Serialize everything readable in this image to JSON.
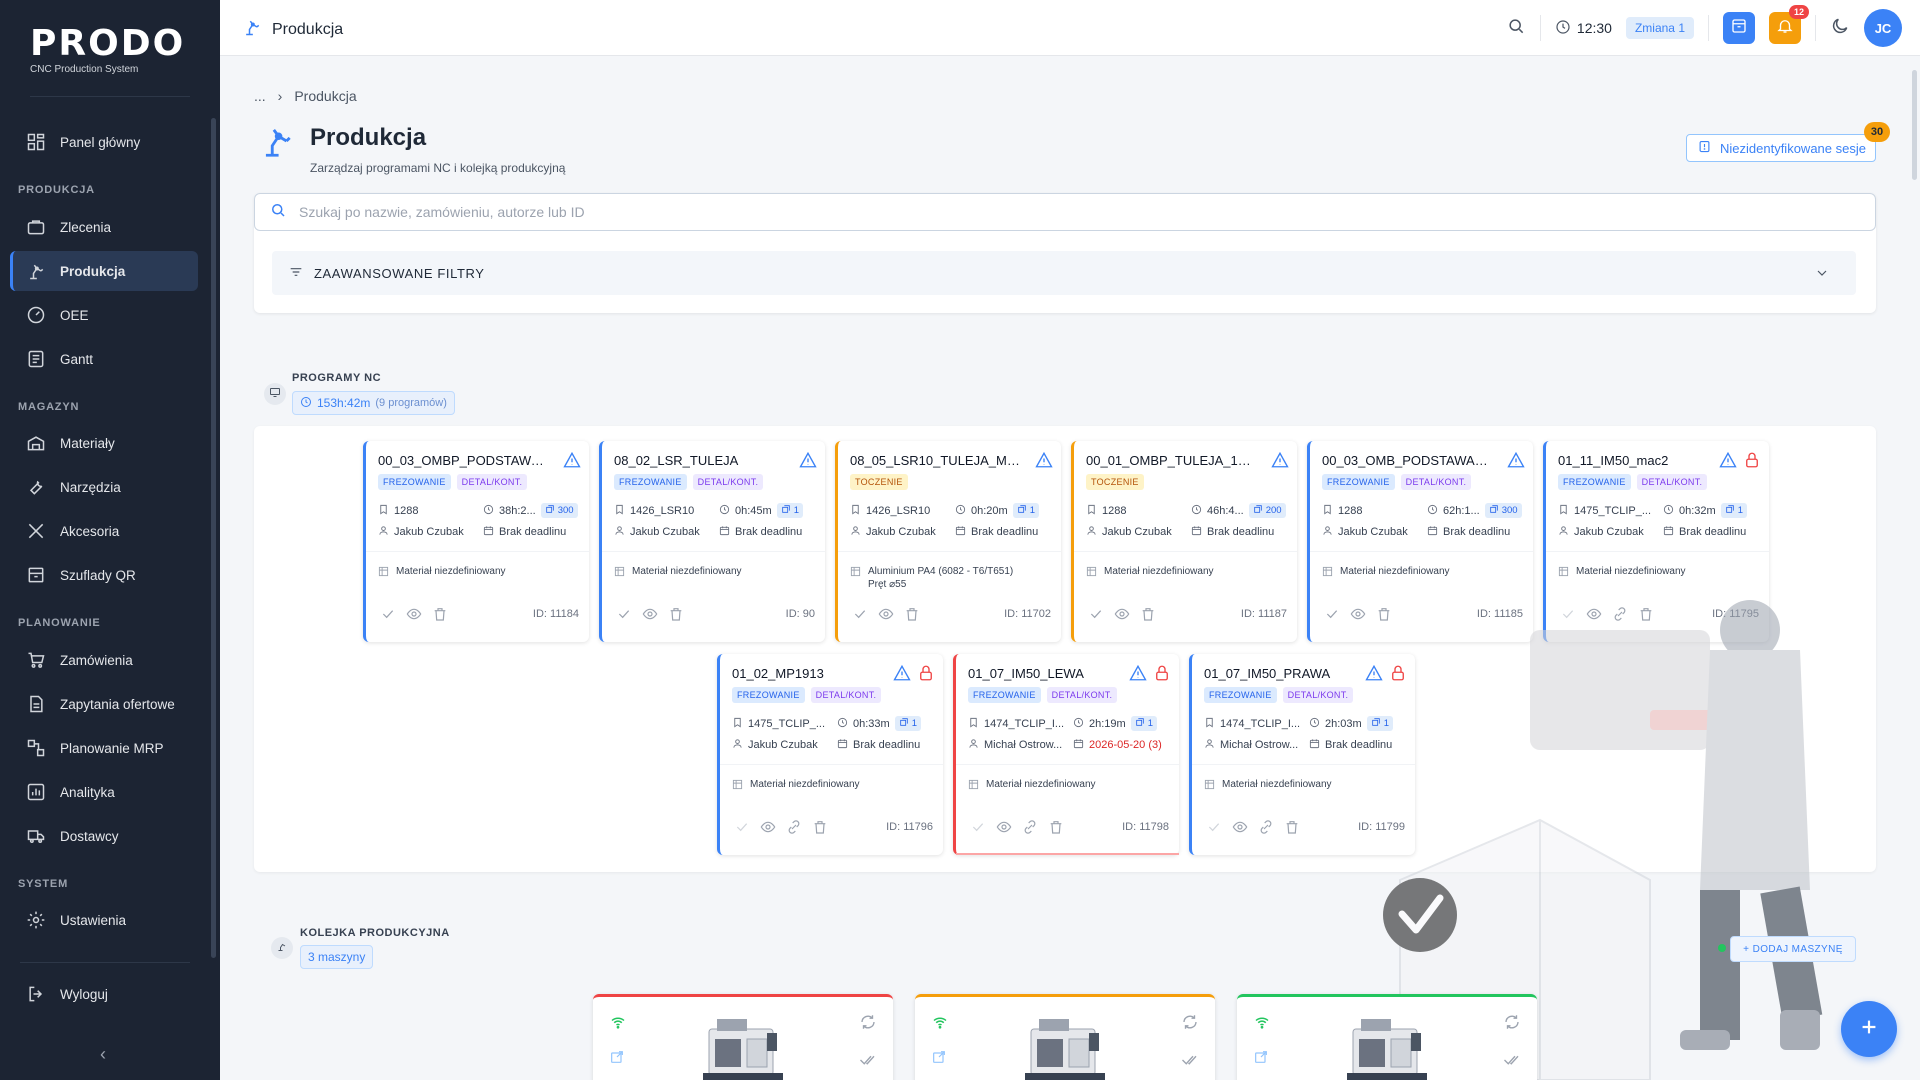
{
  "app": {
    "logo_word": "PRODO",
    "logo_sub": "CNC Production System"
  },
  "sidebar": {
    "items": [
      {
        "label": "Panel główny",
        "icon": "dashboard-icon"
      },
      {
        "label": "Zlecenia",
        "icon": "briefcase-icon"
      },
      {
        "label": "Produkcja",
        "icon": "robot-arm-icon",
        "active": true
      },
      {
        "label": "OEE",
        "icon": "gauge-icon"
      },
      {
        "label": "Gantt",
        "icon": "chart-list-icon"
      },
      {
        "label": "Materiały",
        "icon": "materials-icon"
      },
      {
        "label": "Narzędzia",
        "icon": "wrench-icon"
      },
      {
        "label": "Akcesoria",
        "icon": "tools-icon"
      },
      {
        "label": "Szuflady QR",
        "icon": "drawer-icon"
      },
      {
        "label": "Zamówienia",
        "icon": "cart-icon"
      },
      {
        "label": "Zapytania ofertowe",
        "icon": "document-icon"
      },
      {
        "label": "Planowanie MRP",
        "icon": "mrp-icon"
      },
      {
        "label": "Analityka",
        "icon": "analytics-icon"
      },
      {
        "label": "Dostawcy",
        "icon": "truck-icon"
      },
      {
        "label": "Ustawienia",
        "icon": "gear-icon"
      },
      {
        "label": "Wyloguj",
        "icon": "logout-icon"
      }
    ],
    "sections": {
      "produkcja": "PRODUKCJA",
      "magazyn": "MAGAZYN",
      "planowanie": "PLANOWANIE",
      "system": "SYSTEM"
    }
  },
  "topbar": {
    "title": "Produkcja",
    "time": "12:30",
    "shift": "Zmiana 1",
    "notifications": "12",
    "avatar": "JC"
  },
  "breadcrumb": {
    "ellipsis": "...",
    "current": "Produkcja"
  },
  "page": {
    "title": "Produkcja",
    "subtitle": "Zarządzaj programami NC i kolejką produkcyjną",
    "unidentified_label": "Niezidentyfikowane sesje",
    "unidentified_count": "30"
  },
  "search": {
    "placeholder": "Szukaj po nazwie, zamówieniu, autorze lub ID"
  },
  "filters": {
    "label": "ZAAWANSOWANE FILTRY"
  },
  "programs": {
    "label": "PROGRAMY NC",
    "total_time": "153h:42m",
    "count": "(9 programów)",
    "cards": [
      {
        "name": "00_03_OMBP_PODSTAWA_M...",
        "color": "#3b82f6",
        "tags": [
          "FREZOWANIE",
          "DETAL/KONT."
        ],
        "order": "1288",
        "time": "38h:2...",
        "qty": "300",
        "author": "Jakub Czubak",
        "deadline": "Brak deadlinu",
        "material": "Materiał niezdefiniowany",
        "material2": "",
        "id": "ID: 11184",
        "lock": false,
        "link": false
      },
      {
        "name": "08_02_LSR_TULEJA",
        "color": "#3b82f6",
        "tags": [
          "FREZOWANIE",
          "DETAL/KONT."
        ],
        "order": "1426_LSR10",
        "time": "0h:45m",
        "qty": "1",
        "author": "Jakub Czubak",
        "deadline": "Brak deadlinu",
        "material": "Materiał niezdefiniowany",
        "material2": "",
        "id": "ID: 90",
        "lock": false,
        "link": false
      },
      {
        "name": "08_05_LSR10_TULEJA_MAC1_co...",
        "color": "#f59e0b",
        "tags": [
          "TOCZENIE"
        ],
        "order": "1426_LSR10",
        "time": "0h:20m",
        "qty": "1",
        "author": "Jakub Czubak",
        "deadline": "Brak deadlinu",
        "material": "Aluminium PA4 (6082 - T6/T651)",
        "material2": "Pręt ⌀55",
        "id": "ID: 11702",
        "lock": false,
        "link": false,
        "nowarn": true
      },
      {
        "name": "00_01_OMBP_TULEJA_150_...",
        "color": "#f59e0b",
        "tags": [
          "TOCZENIE"
        ],
        "order": "1288",
        "time": "46h:4...",
        "qty": "200",
        "author": "Jakub Czubak",
        "deadline": "Brak deadlinu",
        "material": "Materiał niezdefiniowany",
        "material2": "",
        "id": "ID: 11187",
        "lock": false,
        "link": false
      },
      {
        "name": "00_03_OMB_PODSTAWA_MAC",
        "color": "#3b82f6",
        "tags": [
          "FREZOWANIE",
          "DETAL/KONT."
        ],
        "order": "1288",
        "time": "62h:1...",
        "qty": "300",
        "author": "Jakub Czubak",
        "deadline": "Brak deadlinu",
        "material": "Materiał niezdefiniowany",
        "material2": "",
        "id": "ID: 11185",
        "lock": false,
        "link": false
      },
      {
        "name": "01_11_IM50_mac2",
        "color": "#3b82f6",
        "tags": [
          "FREZOWANIE",
          "DETAL/KONT."
        ],
        "order": "1475_TCLIP_...",
        "time": "0h:32m",
        "qty": "1",
        "author": "Jakub Czubak",
        "deadline": "Brak deadlinu",
        "material": "Materiał niezdefiniowany",
        "material2": "",
        "id": "ID: 11795",
        "lock": true,
        "link": true
      },
      {
        "name": "01_02_MP1913",
        "color": "#3b82f6",
        "tags": [
          "FREZOWANIE",
          "DETAL/KONT."
        ],
        "order": "1475_TCLIP_...",
        "time": "0h:33m",
        "qty": "1",
        "author": "Jakub Czubak",
        "deadline": "Brak deadlinu",
        "material": "Materiał niezdefiniowany",
        "material2": "",
        "id": "ID: 11796",
        "lock": true,
        "link": true
      },
      {
        "name": "01_07_IM50_LEWA",
        "color": "#ef4444",
        "tags": [
          "FREZOWANIE",
          "DETAL/KONT."
        ],
        "order": "1474_TCLIP_I...",
        "time": "2h:19m",
        "qty": "1",
        "author": "Michał Ostrow...",
        "deadline": "2026-05-20 (3)",
        "deadline_red": true,
        "material": "Materiał niezdefiniowany",
        "material2": "",
        "id": "ID: 11798",
        "lock": true,
        "link": true
      },
      {
        "name": "01_07_IM50_PRAWA",
        "color": "#3b82f6",
        "tags": [
          "FREZOWANIE",
          "DETAL/KONT."
        ],
        "order": "1474_TCLIP_I...",
        "time": "2h:03m",
        "qty": "1",
        "author": "Michał Ostrow...",
        "deadline": "Brak deadlinu",
        "material": "Materiał niezdefiniowany",
        "material2": "",
        "id": "ID: 11799",
        "lock": true,
        "link": true
      }
    ]
  },
  "queue": {
    "label": "KOLEJKA PRODUKCYJNA",
    "count": "3 maszyny",
    "add_label": "+ DODAJ MASZYNĘ",
    "machines": [
      {
        "status_color": "#ef4444"
      },
      {
        "status_color": "#f59e0b"
      },
      {
        "status_color": "#22c55e"
      }
    ]
  }
}
